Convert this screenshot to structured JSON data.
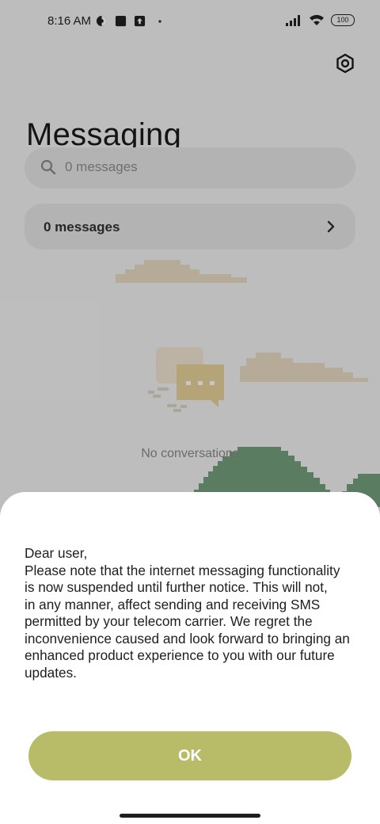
{
  "status_bar": {
    "time": "8:16 AM",
    "battery": "100",
    "left_icons": [
      "vpn-icon",
      "notification-square-icon",
      "upload-icon",
      "dot-icon"
    ],
    "right_icons": [
      "signal-icon",
      "wifi-icon",
      "battery-icon"
    ]
  },
  "header": {
    "title": "Messaging",
    "settings_icon": "gear-icon"
  },
  "search": {
    "placeholder": "0 messages",
    "icon": "search-icon"
  },
  "messages_row": {
    "label": "0 messages",
    "icon": "chevron-right-icon"
  },
  "empty_state": {
    "label": "No conversations"
  },
  "dialog": {
    "lines": [
      "Dear user,",
      "Please note that the internet messaging functionality",
      "is now suspended until further notice. This will not,",
      "in any manner, affect sending and receiving SMS",
      "permitted by your telecom carrier. We regret the",
      "inconvenience caused and look forward to bringing an",
      "enhanced product experience to you with our future",
      "updates."
    ],
    "ok_label": "OK"
  },
  "colors": {
    "accent": "#b8bb68",
    "background": "#f3f3f3",
    "card": "#e6e6e6",
    "hill": "#74a07d",
    "cloud": "#eadcc3"
  }
}
